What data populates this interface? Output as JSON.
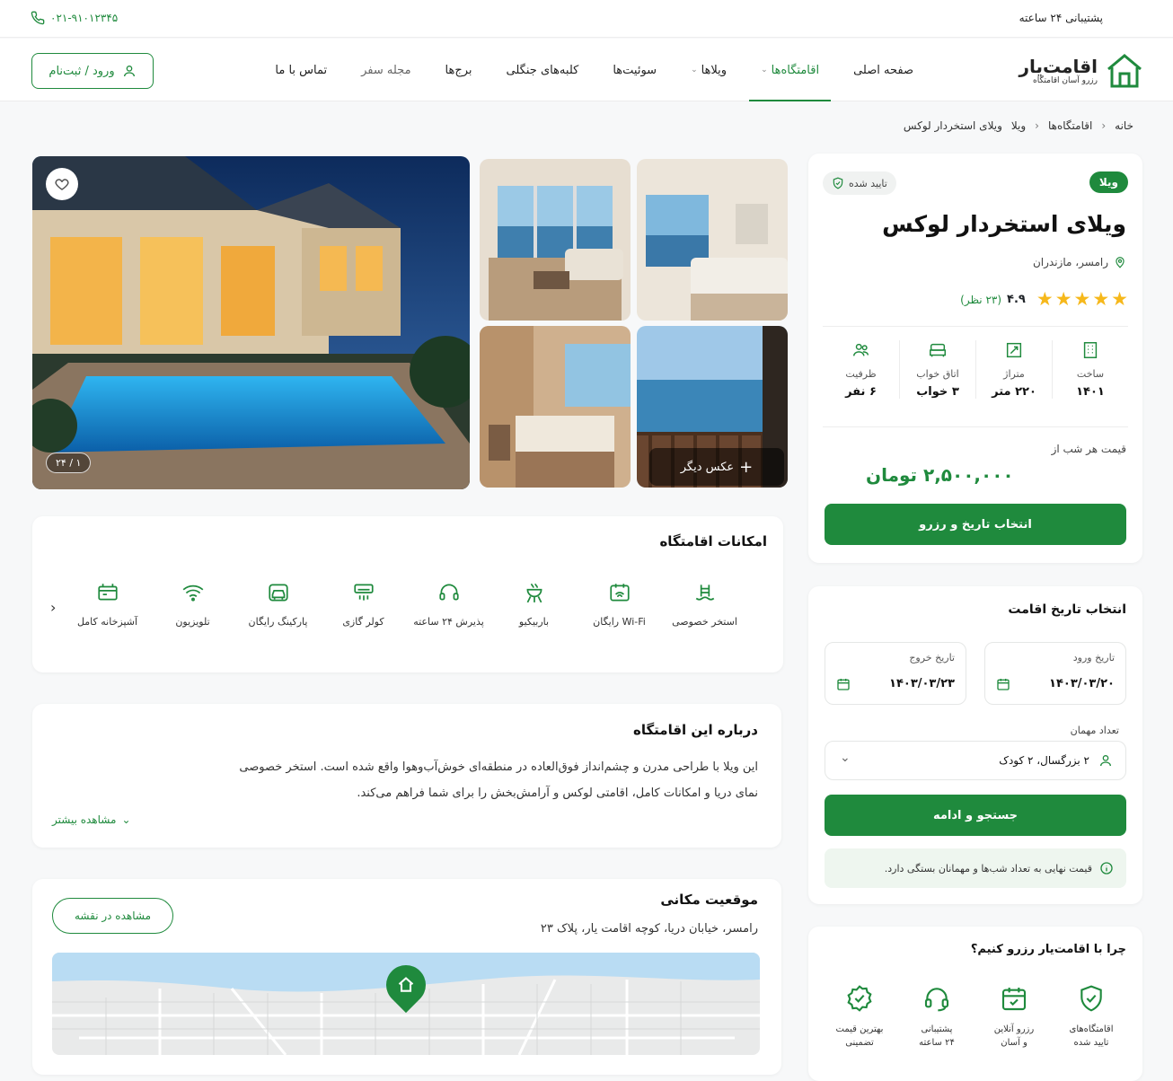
{
  "topbar": {
    "support": "پشتیبانی ۲۴ ساعته",
    "phone": "۰۲۱-۹۱۰۱۲۳۴۵"
  },
  "logo": {
    "name": "اقامت‌یار",
    "tagline": "رزرو آسان اقامتگاه"
  },
  "nav": {
    "items": [
      {
        "label": "صفحه اصلی"
      },
      {
        "label": "اقامتگاه‌ها"
      },
      {
        "label": "ویلاها"
      },
      {
        "label": "سوئیت‌ها"
      },
      {
        "label": "کلبه‌های جنگلی"
      },
      {
        "label": "برج‌ها"
      },
      {
        "label": "مجله سفر"
      },
      {
        "label": "تماس با ما"
      }
    ],
    "login": "ورود / ثبت‌نام"
  },
  "breadcrumb": [
    "خانه",
    "اقامتگاه‌ها",
    "ویلا",
    "ویلای استخردار لوکس"
  ],
  "property": {
    "type_badge": "ویلا",
    "verified": "تایید شده",
    "title": "ویلای استخردار لوکس",
    "location": "رامسر، مازندران",
    "rating": "۴.۹",
    "reviews": "(۲۳ نظر)",
    "stars": 5,
    "specs": [
      {
        "icon": "building-icon",
        "label": "ساخت",
        "value": "۱۴۰۱"
      },
      {
        "icon": "area-icon",
        "label": "متراژ",
        "value": "۲۲۰ متر"
      },
      {
        "icon": "bed-icon",
        "label": "اتاق خواب",
        "value": "۳ خواب"
      },
      {
        "icon": "users-icon",
        "label": "ظرفیت",
        "value": "۶ نفر"
      }
    ],
    "price_label": "قیمت هر شب از",
    "price": "۲,۵۰۰,۰۰۰ تومان",
    "cta": "انتخاب تاریخ و رزرو"
  },
  "gallery": {
    "counter": "۱ / ۲۴",
    "more": "عکس دیگر"
  },
  "booking": {
    "title": "انتخاب تاریخ اقامت",
    "checkin_label": "تاریخ ورود",
    "checkin_value": "۱۴۰۳/۰۳/۲۰",
    "checkout_label": "تاریخ خروج",
    "checkout_value": "۱۴۰۳/۰۳/۲۳",
    "guests_label": "تعداد مهمان",
    "guests_value": "۲ بزرگسال، ۲ کودک",
    "search": "جستجو و ادامه",
    "note": "قیمت نهایی به تعداد شب‌ها و مهمانان بستگی دارد."
  },
  "amenities": {
    "title": "امکانات اقامتگاه",
    "items": [
      {
        "icon": "pool-icon",
        "label": "استخر خصوصی"
      },
      {
        "icon": "wifi-box-icon",
        "label": "Wi-Fi رایگان"
      },
      {
        "icon": "bbq-icon",
        "label": "باربیکیو"
      },
      {
        "icon": "headset-icon",
        "label": "پذیرش ۲۴ ساعته"
      },
      {
        "icon": "ac-icon",
        "label": "کولر گازی"
      },
      {
        "icon": "parking-icon",
        "label": "پارکینگ رایگان"
      },
      {
        "icon": "wifi-icon",
        "label": "تلویزیون"
      },
      {
        "icon": "kitchen-icon",
        "label": "آشپزخانه کامل"
      }
    ]
  },
  "about": {
    "title": "درباره این اقامتگاه",
    "line1": "این ویلا با طراحی مدرن و چشم‌انداز فوق‌العاده در منطقه‌ای خوش‌آب‌وهوا واقع شده است. استخر خصوصی",
    "line2": "نمای دریا و امکانات کامل، اقامتی لوکس و آرامش‌بخش را برای شما فراهم می‌کند.",
    "more": "مشاهده بیشتر"
  },
  "location": {
    "title": "موقعیت مکانی",
    "address": "رامسر، خیابان دریا، کوچه اقامت یار، پلاک ۲۳",
    "map_btn": "مشاهده در نقشه"
  },
  "why": {
    "title": "چرا با اقامت‌یار رزرو کنیم؟",
    "items": [
      {
        "icon": "shield-check-icon",
        "l1": "اقامتگاه‌های",
        "l2": "تایید شده"
      },
      {
        "icon": "calendar-check-icon",
        "l1": "رزرو آنلاین",
        "l2": "و آسان"
      },
      {
        "icon": "headset-icon",
        "l1": "پشتیبانی",
        "l2": "۲۴ ساعته"
      },
      {
        "icon": "badge-check-icon",
        "l1": "بهترین قیمت",
        "l2": "تضمینی"
      }
    ]
  },
  "colors": {
    "accent": "#1f8a3d",
    "star": "#f6b81b",
    "bg": "#f7f8f9"
  }
}
